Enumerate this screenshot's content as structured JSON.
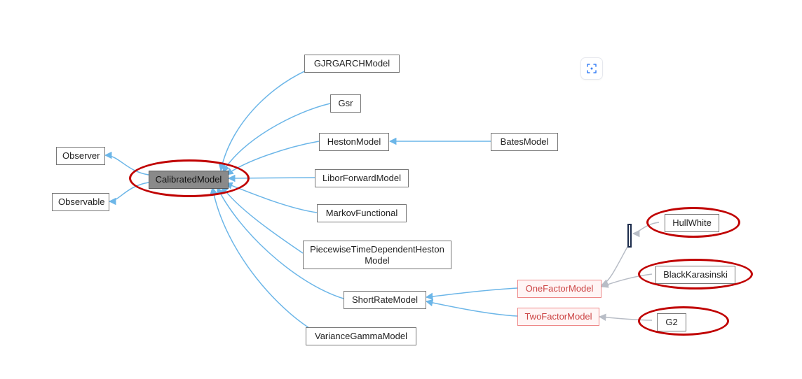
{
  "diagram": {
    "focus": "CalibratedModel",
    "nodes": {
      "observer": "Observer",
      "observable": "Observable",
      "calibrated": "CalibratedModel",
      "gjrgarch": "GJRGARCHModel",
      "gsr": "Gsr",
      "heston": "HestonModel",
      "bates": "BatesModel",
      "libor": "LiborForwardModel",
      "markov": "MarkovFunctional",
      "ptdh": "PiecewiseTimeDependentHestonModel",
      "shortrate": "ShortRateModel",
      "vargamma": "VarianceGammaModel",
      "onefactor": "OneFactorModel",
      "twofactor": "TwoFactorModel",
      "hullwhite": "HullWhite",
      "bk": "BlackKarasinski",
      "g2": "G2"
    },
    "highlights": [
      "calibrated",
      "hullwhite",
      "bk",
      "g2"
    ]
  },
  "toolbar": {
    "focus_icon": "focus-icon"
  },
  "colors": {
    "edge": "#6cb6e8",
    "edge_gray": "#b8bdc6",
    "ring": "#c00000"
  }
}
